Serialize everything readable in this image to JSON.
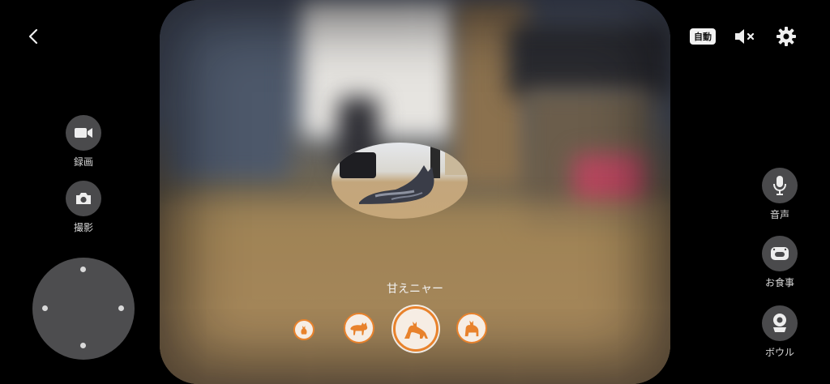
{
  "nav": {
    "back_icon": "chevron-left-icon"
  },
  "top_right": {
    "auto_label": "自動",
    "mute_icon": "speaker-muted-icon",
    "settings_icon": "gear-icon"
  },
  "left_panel": {
    "record": {
      "label": "録画",
      "icon": "video-camera-icon"
    },
    "photo": {
      "label": "撮影",
      "icon": "camera-icon"
    },
    "joystick": {
      "icon": "direction-pad"
    }
  },
  "right_panel": {
    "voice": {
      "label": "音声",
      "icon": "microphone-icon"
    },
    "meal": {
      "label": "お食事",
      "icon": "food-dispenser-icon"
    },
    "bowl": {
      "label": "ボウル",
      "icon": "bowl-camera-icon"
    }
  },
  "sounds": {
    "selected_label": "甘えニャー",
    "items": [
      "small-sitting-cat-icon",
      "walking-cat-icon",
      "stretching-cat-icon",
      "standing-cat-icon"
    ],
    "selected_index": 2
  },
  "colors": {
    "accent": "#e8822c",
    "button_bg": "#4a4a4c",
    "background": "#000000"
  }
}
